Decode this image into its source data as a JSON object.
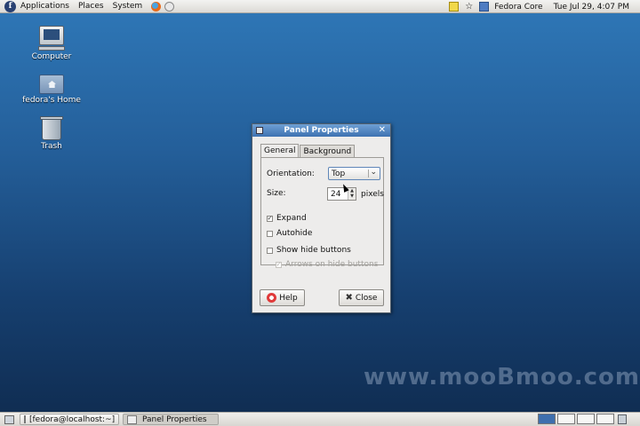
{
  "top_panel": {
    "menus": [
      "Applications",
      "Places",
      "System"
    ],
    "hostname": "Fedora Core",
    "clock": "Tue Jul 29,  4:07 PM"
  },
  "desktop_icons": [
    {
      "label": "Computer"
    },
    {
      "label": "fedora's Home"
    },
    {
      "label": "Trash"
    }
  ],
  "dialog": {
    "title": "Panel Properties",
    "tabs": [
      "General",
      "Background"
    ],
    "active_tab": "General",
    "orientation_label": "Orientation:",
    "orientation_value": "Top",
    "size_label": "Size:",
    "size_value": "24",
    "size_unit": "pixels",
    "options": [
      {
        "label": "Expand",
        "checked": true,
        "enabled": true
      },
      {
        "label": "Autohide",
        "checked": false,
        "enabled": true
      },
      {
        "label": "Show hide buttons",
        "checked": false,
        "enabled": true
      },
      {
        "label": "Arrows on hide buttons",
        "checked": true,
        "enabled": false
      }
    ],
    "help_label": "Help",
    "close_label": "Close"
  },
  "taskbar": {
    "items": [
      "[fedora@localhost:~]",
      "Panel Properties"
    ]
  },
  "watermark": "www.mooBmoo.com",
  "colors": {
    "titlebar": "#4a80bf",
    "desktop_top": "#2f78b8",
    "desktop_bottom": "#0f2b4f",
    "panel": "#e6e4e0"
  }
}
